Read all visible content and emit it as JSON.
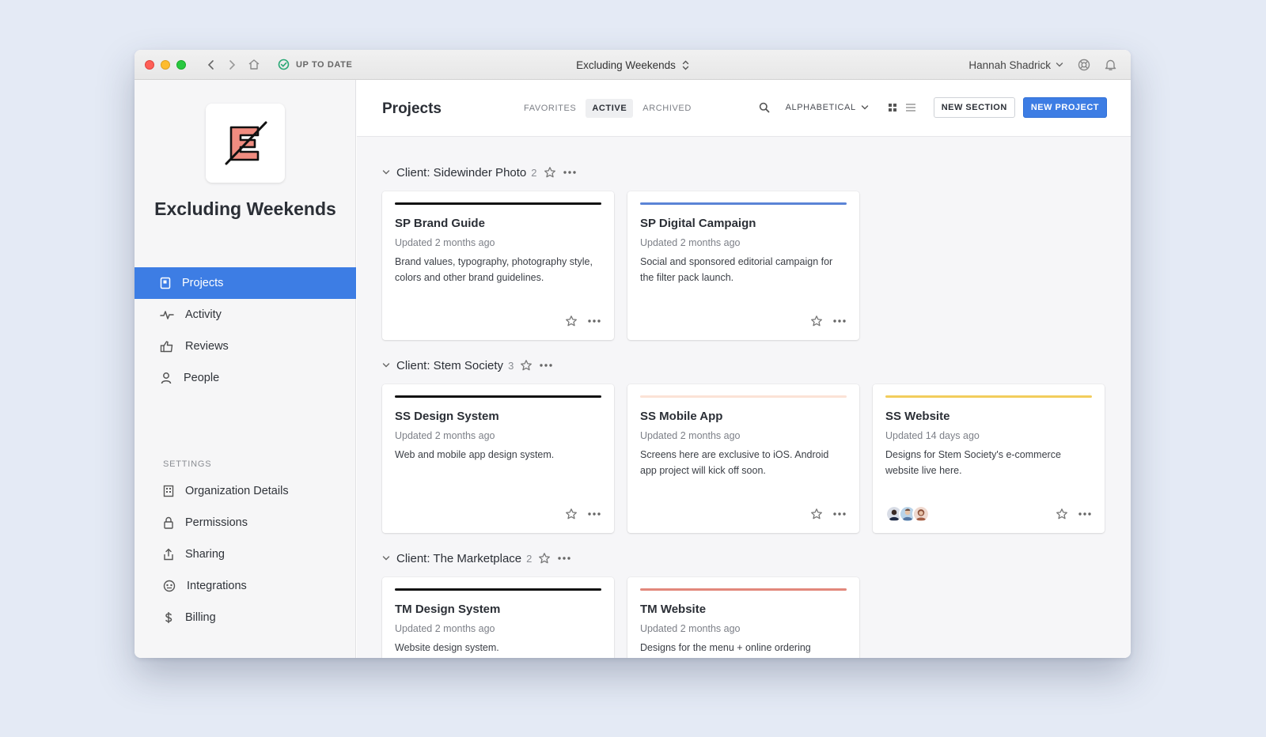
{
  "titlebar": {
    "sync_status": "UP TO DATE",
    "window_title": "Excluding Weekends",
    "user_name": "Hannah Shadrick"
  },
  "sidebar": {
    "org_name": "Excluding Weekends",
    "nav": [
      {
        "label": "Projects",
        "icon": "projects-icon",
        "active": true
      },
      {
        "label": "Activity",
        "icon": "activity-icon"
      },
      {
        "label": "Reviews",
        "icon": "thumbs-up-icon"
      },
      {
        "label": "People",
        "icon": "person-icon"
      }
    ],
    "settings_heading": "SETTINGS",
    "settings": [
      {
        "label": "Organization Details",
        "icon": "building-icon"
      },
      {
        "label": "Permissions",
        "icon": "lock-icon"
      },
      {
        "label": "Sharing",
        "icon": "share-icon"
      },
      {
        "label": "Integrations",
        "icon": "integrations-icon"
      },
      {
        "label": "Billing",
        "icon": "dollar-icon"
      }
    ]
  },
  "header": {
    "title": "Projects",
    "tabs": [
      {
        "label": "FAVORITES"
      },
      {
        "label": "ACTIVE",
        "active": true
      },
      {
        "label": "ARCHIVED"
      }
    ],
    "sort_label": "ALPHABETICAL",
    "new_section_label": "NEW SECTION",
    "new_project_label": "NEW PROJECT"
  },
  "sections": [
    {
      "name": "Client: Sidewinder Photo",
      "count": "2",
      "projects": [
        {
          "title": "SP Brand Guide",
          "updated": "Updated 2 months ago",
          "description": "Brand values, typography, photography style, colors and other brand guidelines.",
          "color": "#111111"
        },
        {
          "title": "SP Digital Campaign",
          "updated": "Updated 2 months ago",
          "description": "Social and sponsored editorial campaign for the filter pack launch.",
          "color": "#5b84d6"
        }
      ]
    },
    {
      "name": "Client: Stem Society",
      "count": "3",
      "projects": [
        {
          "title": "SS Design System",
          "updated": "Updated 2 months ago",
          "description": "Web and mobile app design system.",
          "color": "#111111"
        },
        {
          "title": "SS Mobile App",
          "updated": "Updated 2 months ago",
          "description": "Screens here are exclusive to iOS. Android app project will kick off soon.",
          "color": "#fbe2d6"
        },
        {
          "title": "SS Website",
          "updated": "Updated 14 days ago",
          "description": "Designs for Stem Society's e-commerce website live here.",
          "color": "#f2cd5c",
          "has_avatars": true
        }
      ]
    },
    {
      "name": "Client: The Marketplace",
      "count": "2",
      "projects": [
        {
          "title": "TM Design System",
          "updated": "Updated 2 months ago",
          "description": "Website design system.",
          "color": "#111111"
        },
        {
          "title": "TM Website",
          "updated": "Updated 2 months ago",
          "description": "Designs for the menu + online ordering system.",
          "color": "#e2887c"
        }
      ]
    }
  ]
}
